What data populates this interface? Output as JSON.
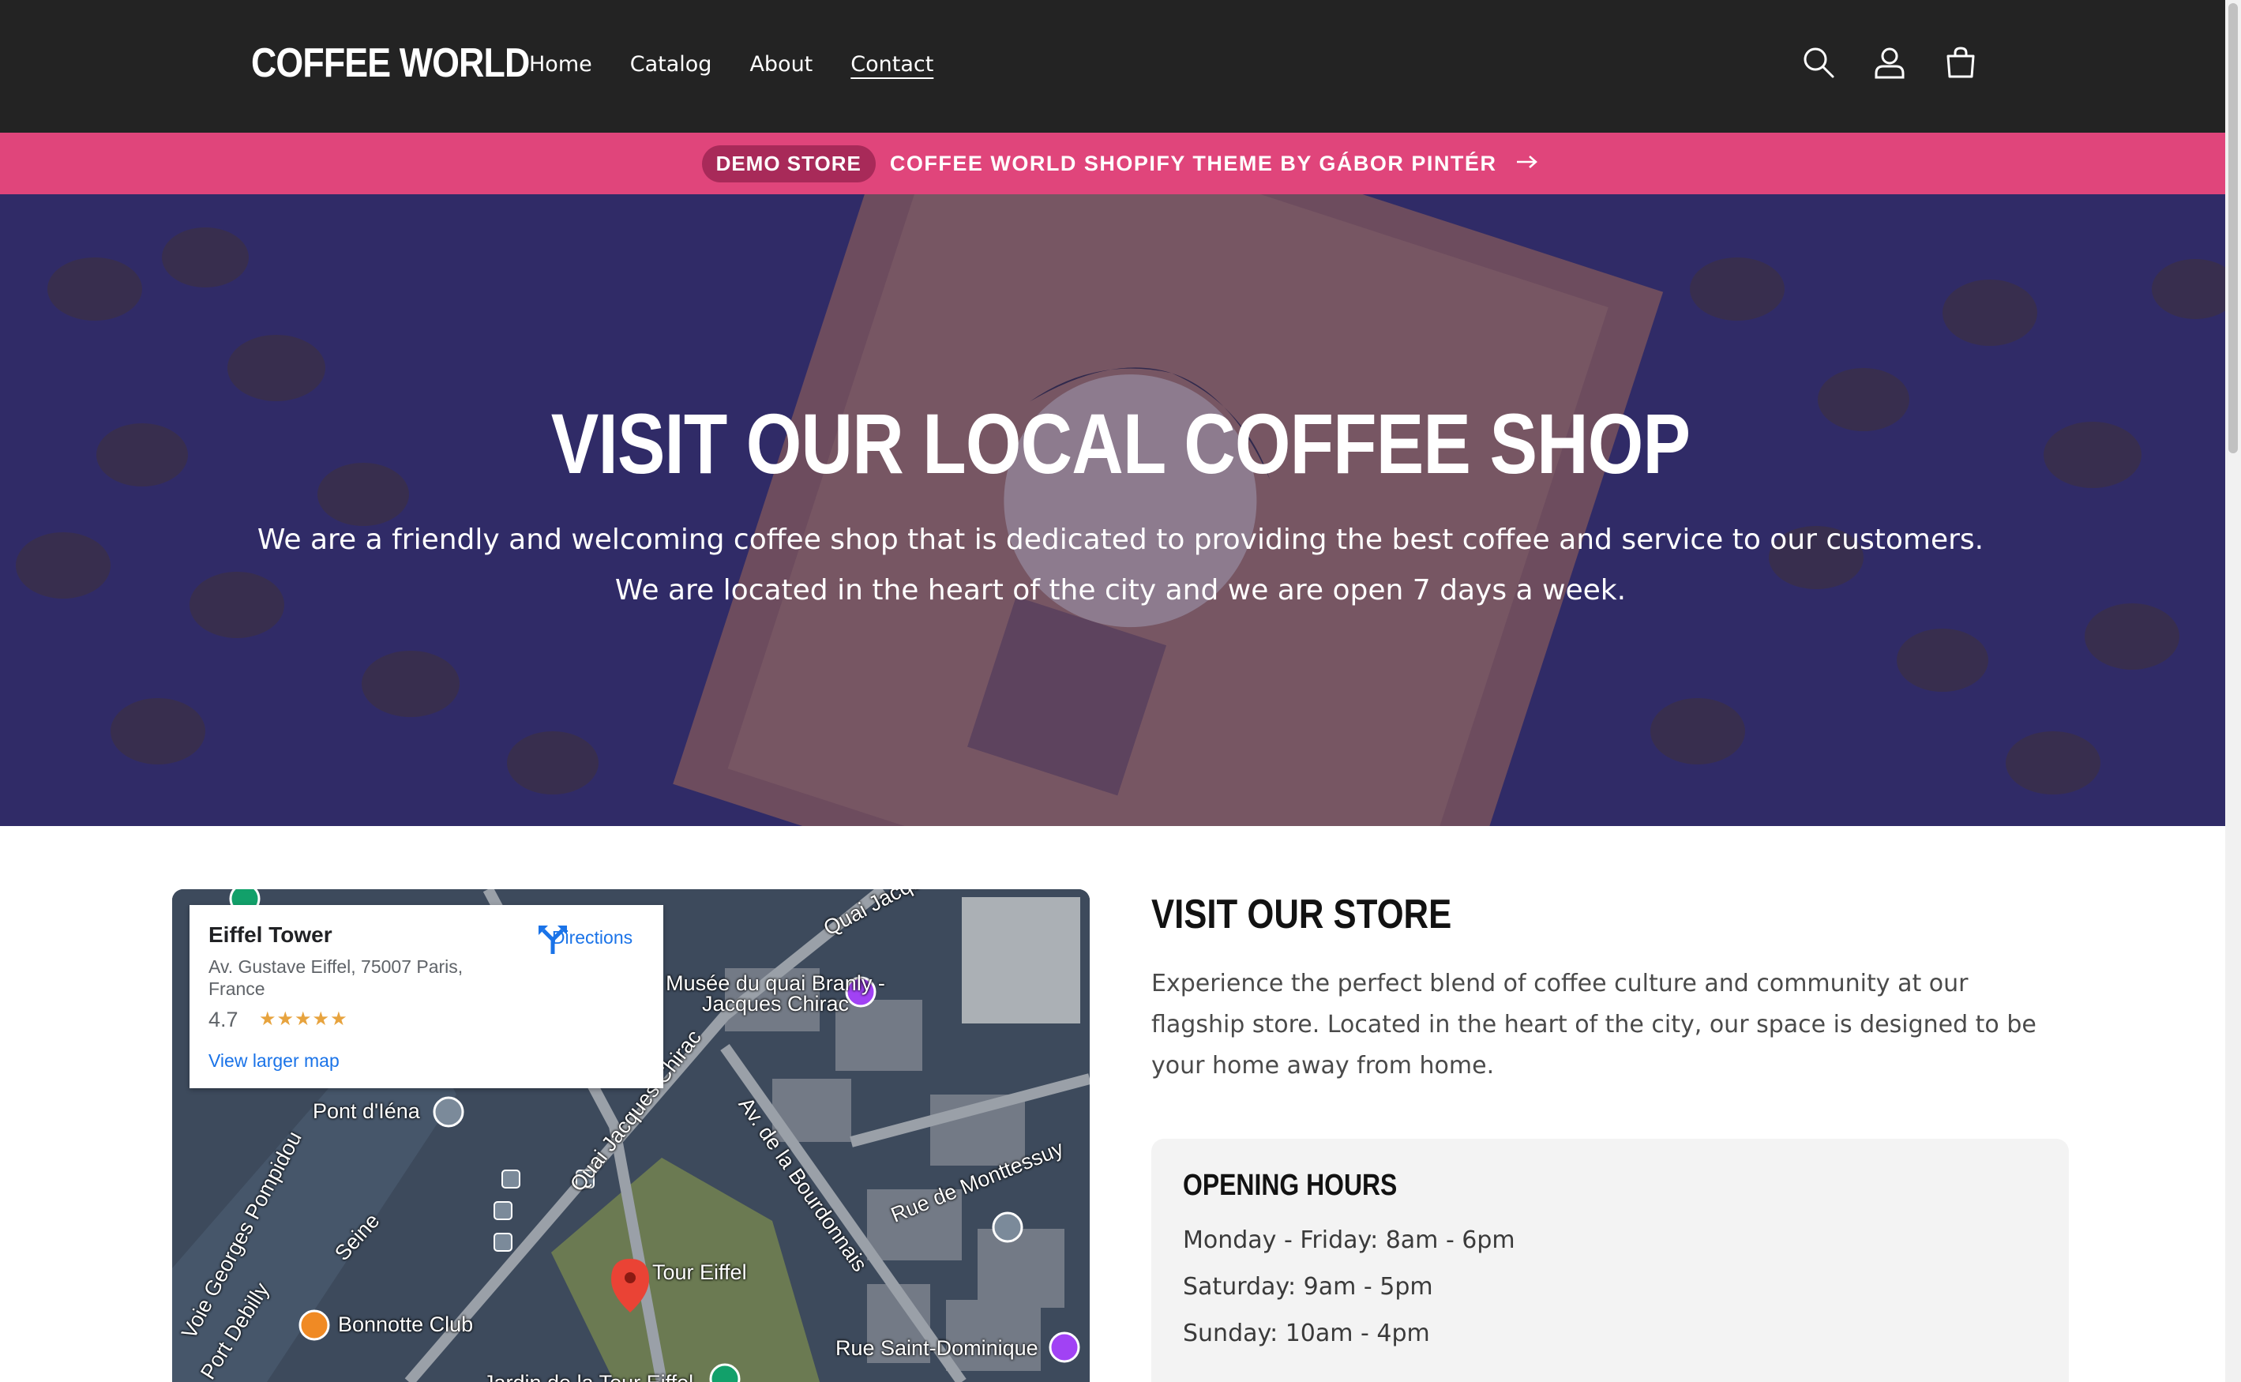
{
  "header": {
    "logo": "COFFEE WORLD",
    "nav": [
      {
        "label": "Home",
        "active": false
      },
      {
        "label": "Catalog",
        "active": false
      },
      {
        "label": "About",
        "active": false
      },
      {
        "label": "Contact",
        "active": true
      }
    ],
    "icons": [
      "search-icon",
      "account-icon",
      "cart-icon"
    ]
  },
  "announcement": {
    "badge": "DEMO STORE",
    "text": "COFFEE WORLD SHOPIFY THEME BY GÁBOR PINTÉR",
    "icon": "arrow-right-icon"
  },
  "hero": {
    "title": "VISIT OUR LOCAL COFFEE SHOP",
    "subtitle": "We are a friendly and welcoming coffee shop that is dedicated to providing the best coffee and service to our customers. We are located in the heart of the city and we are open 7 days a week."
  },
  "map": {
    "place_name": "Eiffel Tower",
    "address": "Av. Gustave Eiffel, 75007 Paris, France",
    "rating": "4.7",
    "stars": "★★★★★",
    "directions_label": "Directions",
    "larger_map_link": "View larger map",
    "labels": {
      "pont_iena": "Pont d'Iéna",
      "musee": "Musée du quai Branly - Jacques Chirac",
      "quai_jacques_top": "Quai Jacques Chirac",
      "quai_jacques_mid": "Quai Jacques Chirac",
      "av_bourdonnais": "Av. de la Bourdonnais",
      "rue_monttessuy": "Rue de Monttessuy",
      "seine": "Seine",
      "tour_eiffel": "Tour Eiffel",
      "bonnotte": "Bonnotte Club",
      "rue_saint_dominique": "Rue Saint-Dominique",
      "jardin": "Jardin de la Tour Eiffel",
      "port_debilly": "Port Debilly",
      "georges_pompidou": "Voie Georges Pompidou"
    }
  },
  "store": {
    "title": "VISIT OUR STORE",
    "description": "Experience the perfect blend of coffee culture and community at our flagship store. Located in the heart of the city, our space is designed to be your home away from home.",
    "hours_title": "OPENING HOURS",
    "hours": [
      "Monday - Friday: 8am - 6pm",
      "Saturday: 9am - 5pm",
      "Sunday: 10am - 4pm"
    ]
  },
  "colors": {
    "header_bg": "#232323",
    "announcement_bg": "#e0457b",
    "badge_bg": "#a82a59",
    "hero_tint": "#2e2f6e",
    "hours_card_bg": "#f3f3f3",
    "link_blue": "#1a73e8"
  }
}
